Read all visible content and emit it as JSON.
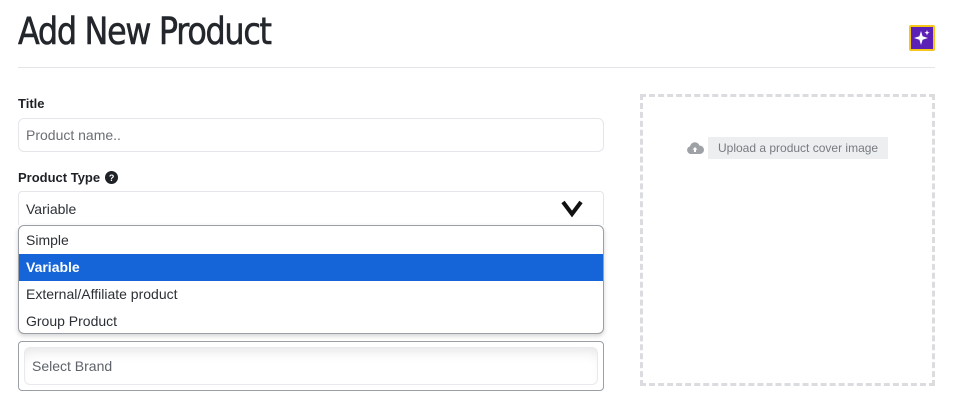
{
  "header": {
    "title": "Add New Product",
    "ai_icon": "sparkle-icon",
    "ai_bg_color": "#5b21b6",
    "ai_border_color": "#f5c518"
  },
  "form": {
    "title_field": {
      "label": "Title",
      "placeholder": "Product name..",
      "value": ""
    },
    "product_type": {
      "label": "Product Type",
      "help_icon": "question-circle-icon",
      "help_glyph": "?",
      "selected": "Variable",
      "chevron_icon": "chevron-down-icon",
      "options": [
        "Simple",
        "Variable",
        "External/Affiliate product",
        "Group Product"
      ],
      "selected_index": 1,
      "selected_color": "#1565d8"
    },
    "brand": {
      "placeholder": "Select Brand"
    }
  },
  "upload": {
    "label": "Upload a product cover image",
    "icon": "cloud-upload-icon"
  }
}
